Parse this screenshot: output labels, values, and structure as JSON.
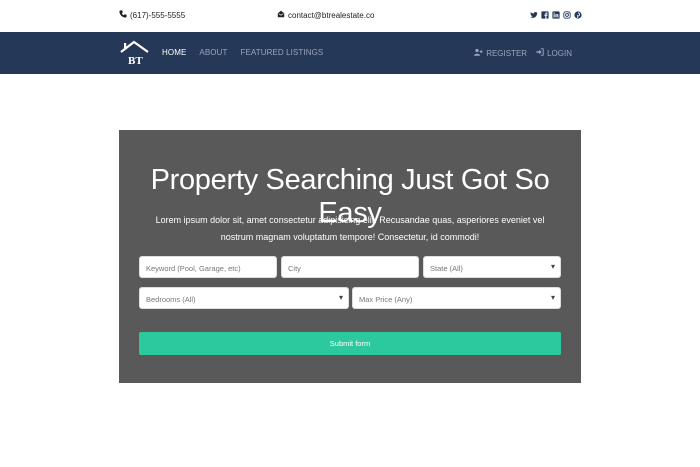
{
  "topbar": {
    "phone": "(617)-555-5555",
    "email": "contact@btrealestate.co",
    "social_icons": [
      "twitter-icon",
      "facebook-icon",
      "linkedin-icon",
      "instagram-icon",
      "pinterest-icon"
    ]
  },
  "navbar": {
    "logo_text": "BT",
    "links": [
      {
        "label": "HOME",
        "active": true
      },
      {
        "label": "ABOUT",
        "active": false
      },
      {
        "label": "FEATURED LISTINGS",
        "active": false
      }
    ],
    "register_label": "REGISTER",
    "login_label": "LOGIN"
  },
  "search": {
    "heading": "Property Searching Just Got So Easy",
    "lead": "Lorem ipsum dolor sit, amet consectetur adipisicing elit. Recusandae quas, asperiores eveniet vel nostrum magnam voluptatum tempore! Consectetur, id commodi!",
    "keyword_placeholder": "Keyword (Pool, Garage, etc)",
    "city_placeholder": "City",
    "state_selected": "State (All)",
    "bedrooms_selected": "Bedrooms (All)",
    "price_selected": "Max Price (Any)",
    "submit_label": "Submit form"
  },
  "colors": {
    "navbar": "#253858",
    "panel": "#595959",
    "submit": "#2dc99e"
  }
}
